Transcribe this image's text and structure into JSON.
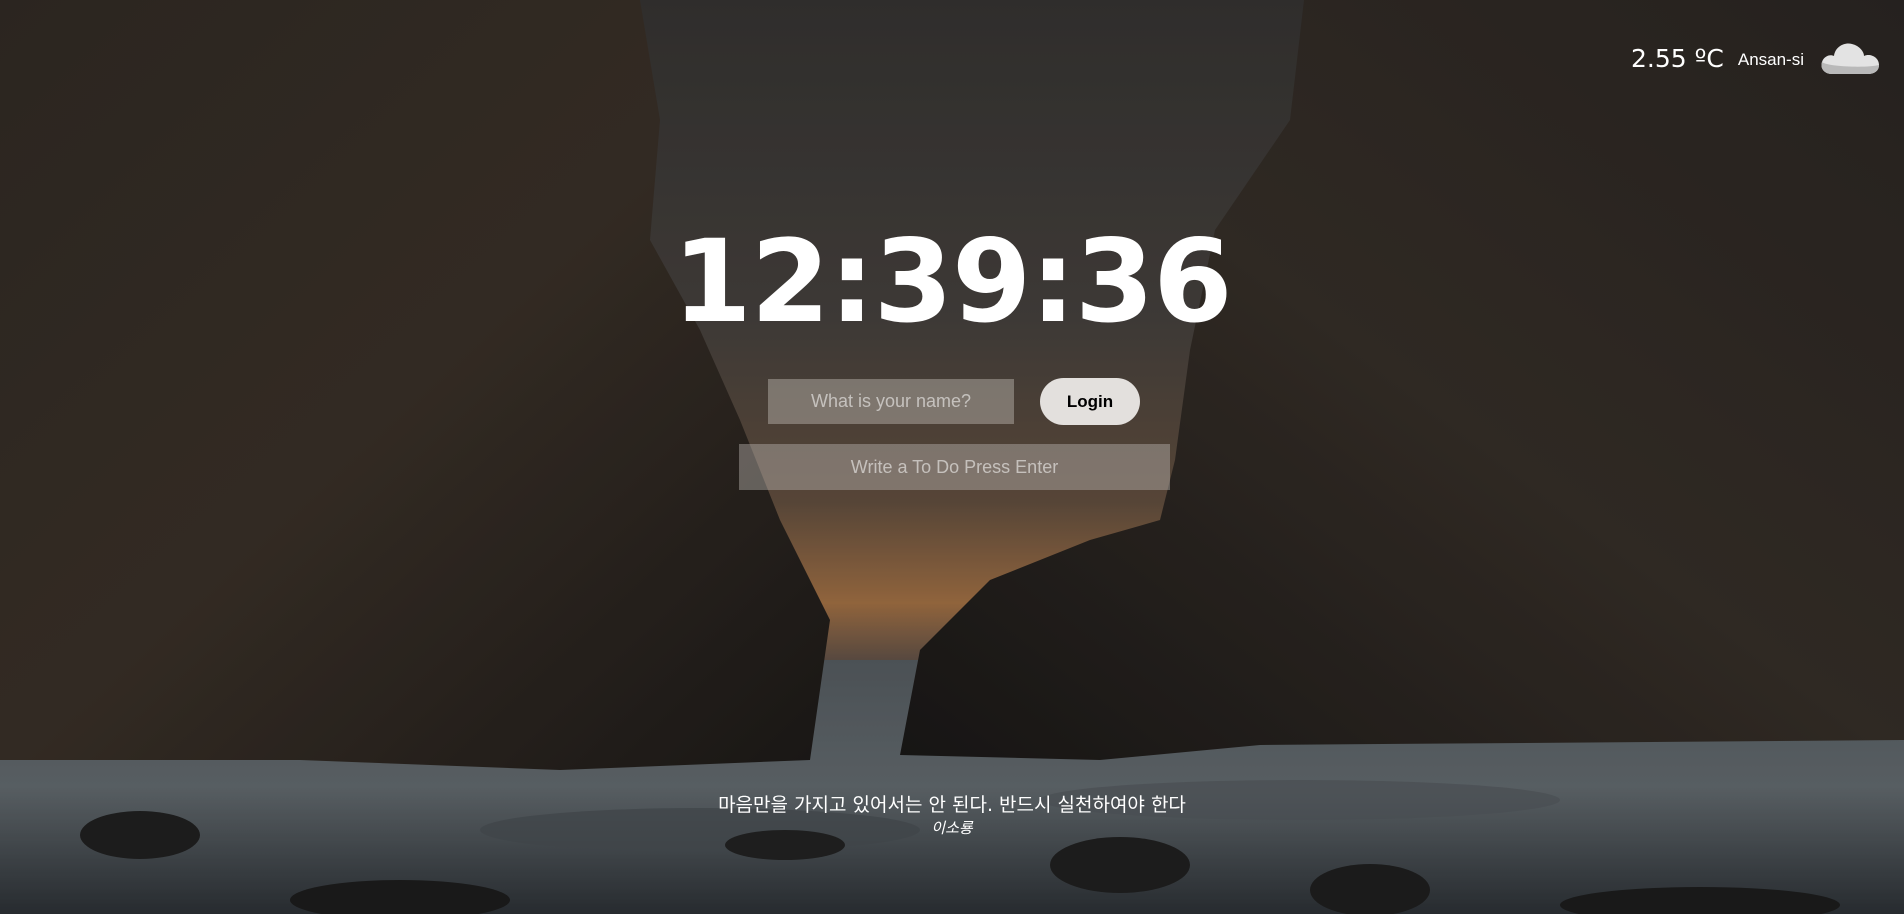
{
  "weather": {
    "temperature": "2.55 ºC",
    "city": "Ansan-si",
    "icon": "cloud-icon"
  },
  "clock": {
    "time": "12:39:36"
  },
  "login": {
    "name_placeholder": "What is your name?",
    "button_label": "Login"
  },
  "todo": {
    "placeholder": "Write a To Do Press Enter"
  },
  "quote": {
    "text": "마음만을 가지고 있어서는 안 된다. 반드시 실천하여야 한다",
    "author": "이소룡"
  }
}
